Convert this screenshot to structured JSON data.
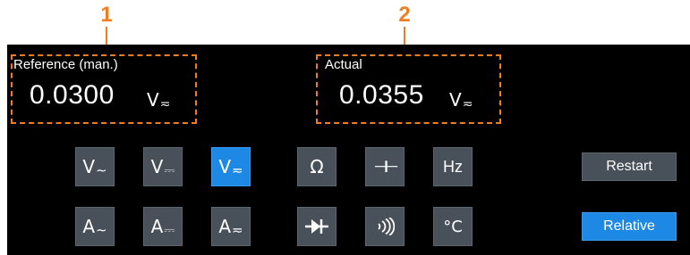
{
  "callouts": {
    "c1": "1",
    "c2": "2"
  },
  "reference": {
    "label": "Reference (man.)",
    "value": "0.0300",
    "unit": "V",
    "unit_mark": "≂"
  },
  "actual": {
    "label": "Actual",
    "value": "0.0355",
    "unit": "V",
    "unit_mark": "≂"
  },
  "modes": {
    "v_ac": {
      "main": "V",
      "mark": "∼"
    },
    "v_dc": {
      "main": "V",
      "mark": "⎓"
    },
    "v_acdc": {
      "main": "V",
      "mark": "≂"
    },
    "resistance": {
      "main": "Ω"
    },
    "capacitance": {
      "main": "⊣⊢"
    },
    "frequency": {
      "main": "Hz"
    },
    "a_ac": {
      "main": "A",
      "mark": "∼"
    },
    "a_dc": {
      "main": "A",
      "mark": "⎓"
    },
    "a_acdc": {
      "main": "A",
      "mark": "≂"
    },
    "diode": {
      "icon": "diode-icon"
    },
    "continuity": {
      "icon": "continuity-icon"
    },
    "temperature": {
      "main": "°C"
    }
  },
  "buttons": {
    "restart": "Restart",
    "relative": "Relative"
  },
  "colors": {
    "accent": "#ef7d22",
    "active": "#1e88e5",
    "button": "#48505a",
    "screen": "#000000"
  }
}
